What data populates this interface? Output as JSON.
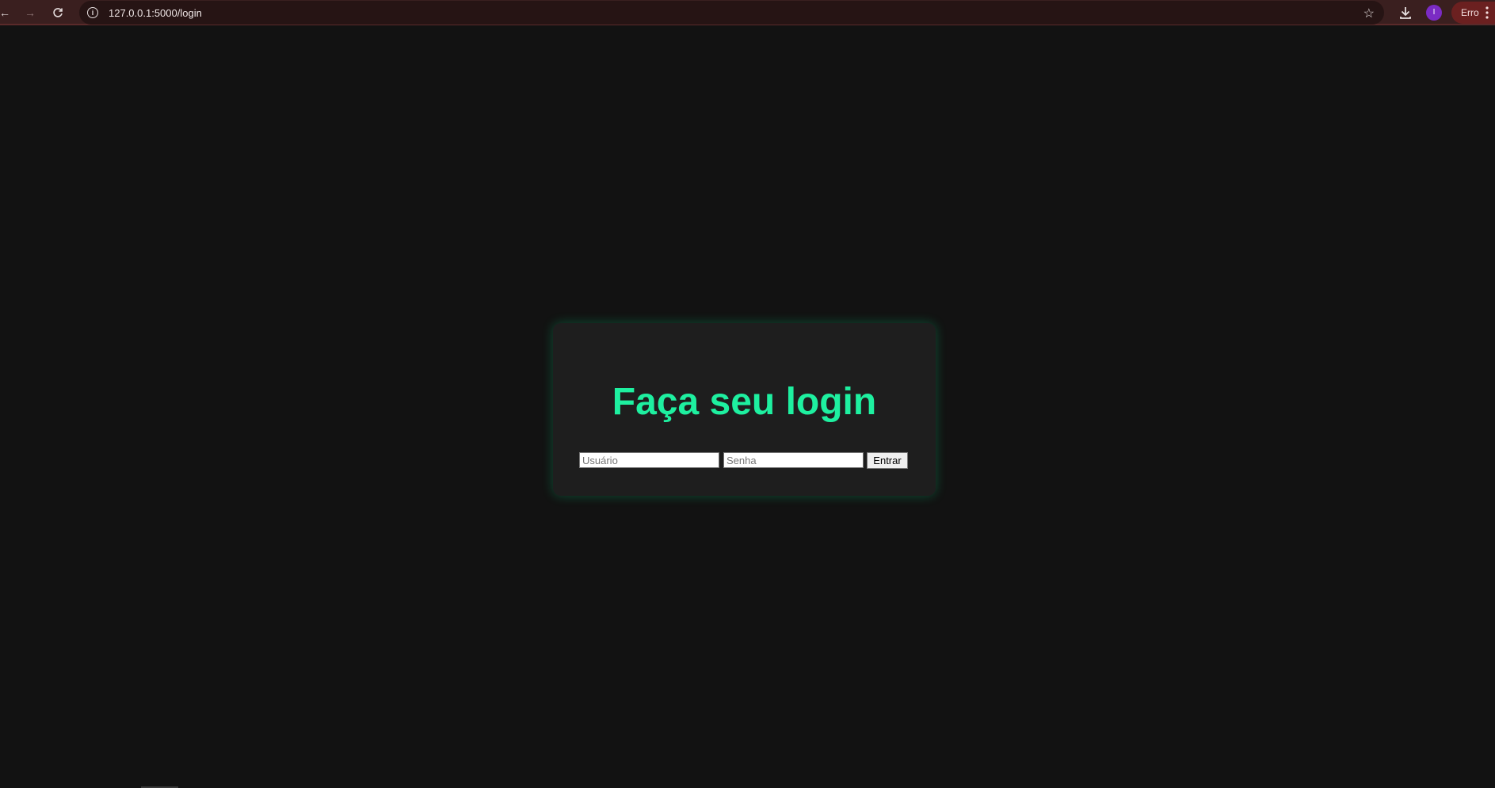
{
  "browser": {
    "url": "127.0.0.1:5000/login",
    "back_icon": "arrow-left-icon",
    "forward_icon": "arrow-right-icon",
    "reload_icon": "reload-icon",
    "site_info_icon": "info-icon",
    "bookmark_icon": "star-icon",
    "download_icon": "download-icon",
    "profile_initial": "I",
    "error_label": "Erro",
    "menu_icon": "more-vertical-icon"
  },
  "login": {
    "title": "Faça seu login",
    "username_placeholder": "Usuário",
    "password_placeholder": "Senha",
    "submit_label": "Entrar"
  },
  "colors": {
    "page_background": "#121212",
    "card_background": "#1e1e1e",
    "title_accent": "#1ef0a0",
    "browser_frame": "#3a1f1f",
    "profile_avatar": "#7b2bc4"
  }
}
